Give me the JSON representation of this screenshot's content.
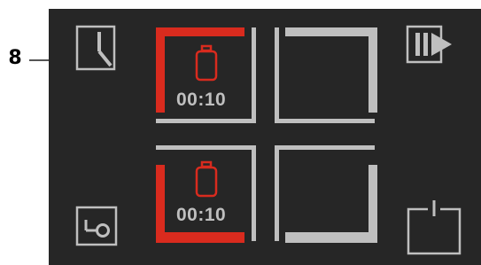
{
  "callout": {
    "number": "8"
  },
  "zones": [
    {
      "id": "top-left",
      "active": true,
      "timer": "00:10",
      "icon": "battery-icon"
    },
    {
      "id": "top-right",
      "active": false
    },
    {
      "id": "bottom-left",
      "active": true,
      "timer": "00:10",
      "icon": "battery-icon"
    },
    {
      "id": "bottom-right",
      "active": false
    }
  ],
  "buttons": {
    "timer": {
      "icon": "clock-icon"
    },
    "play_pause": {
      "icon": "pause-play-icon"
    },
    "lock": {
      "icon": "key-lock-icon"
    },
    "power": {
      "icon": "power-icon"
    }
  },
  "colors": {
    "background": "#262626",
    "active_accent": "#d92b1e",
    "inactive": "#bfbfbf",
    "icon_outline": "#bfbfbf"
  }
}
